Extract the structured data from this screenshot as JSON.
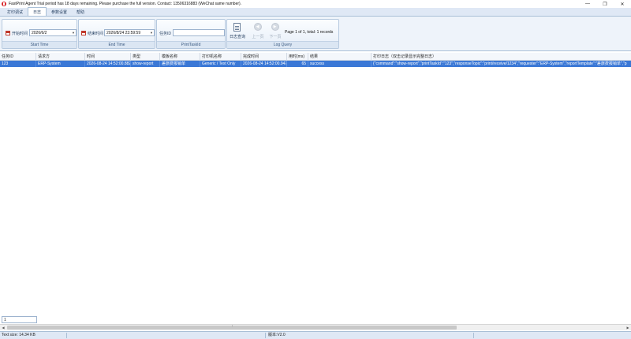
{
  "window": {
    "title": "FastPrint Agent Trial period has 18 days remaining. Please purchase the full version. Contact: 13506316883 (WeChat same number).",
    "minimize": "—",
    "maximize": "❐",
    "close": "✕"
  },
  "tabs": [
    {
      "label": "打印调试"
    },
    {
      "label": "日志"
    },
    {
      "label": "参数设置"
    },
    {
      "label": "帮助"
    }
  ],
  "ribbon": {
    "start_time": {
      "label": "开始时间",
      "value": "2026/6/2",
      "caption": "Start Time"
    },
    "end_time": {
      "label": "结束时间",
      "value": "2026/8/24 23:59:59",
      "caption": "End Time"
    },
    "task_id": {
      "label": "任务ID",
      "value": "",
      "caption": "PrintTaskId"
    },
    "log_query": {
      "query_label": "日志查询",
      "prev_label": "上一页",
      "next_label": "下一页",
      "page_info": "Page 1 of 1, total: 1 records",
      "caption": "Log Query"
    }
  },
  "grid": {
    "columns": [
      "任务ID",
      "请求方",
      "时间",
      "类型",
      "模板名称",
      "打印机名称",
      "完成时间",
      "用时(ms)",
      "结果",
      "打印日志（双击记录显示完整日志）"
    ],
    "rows": [
      [
        "123",
        "ERP-System",
        "2026-08-24 14:52:00.882",
        "show-report",
        "差旅费报销单",
        "Generic / Text Only",
        "2026-08-24 14:52:00.947",
        "65",
        "success",
        "{\"command\":\"show-report\",\"printTaskId\":\"123\",\"responseTopic\":\"print/receive/1234\",\"requester\":\"ERP-System\",\"reportTemplate\":\"差旅费报销单\",\"p"
      ]
    ]
  },
  "pager": {
    "value": "1"
  },
  "status": {
    "text_size": "Text size: 14.34 KB",
    "version": "版本:V2.0"
  }
}
